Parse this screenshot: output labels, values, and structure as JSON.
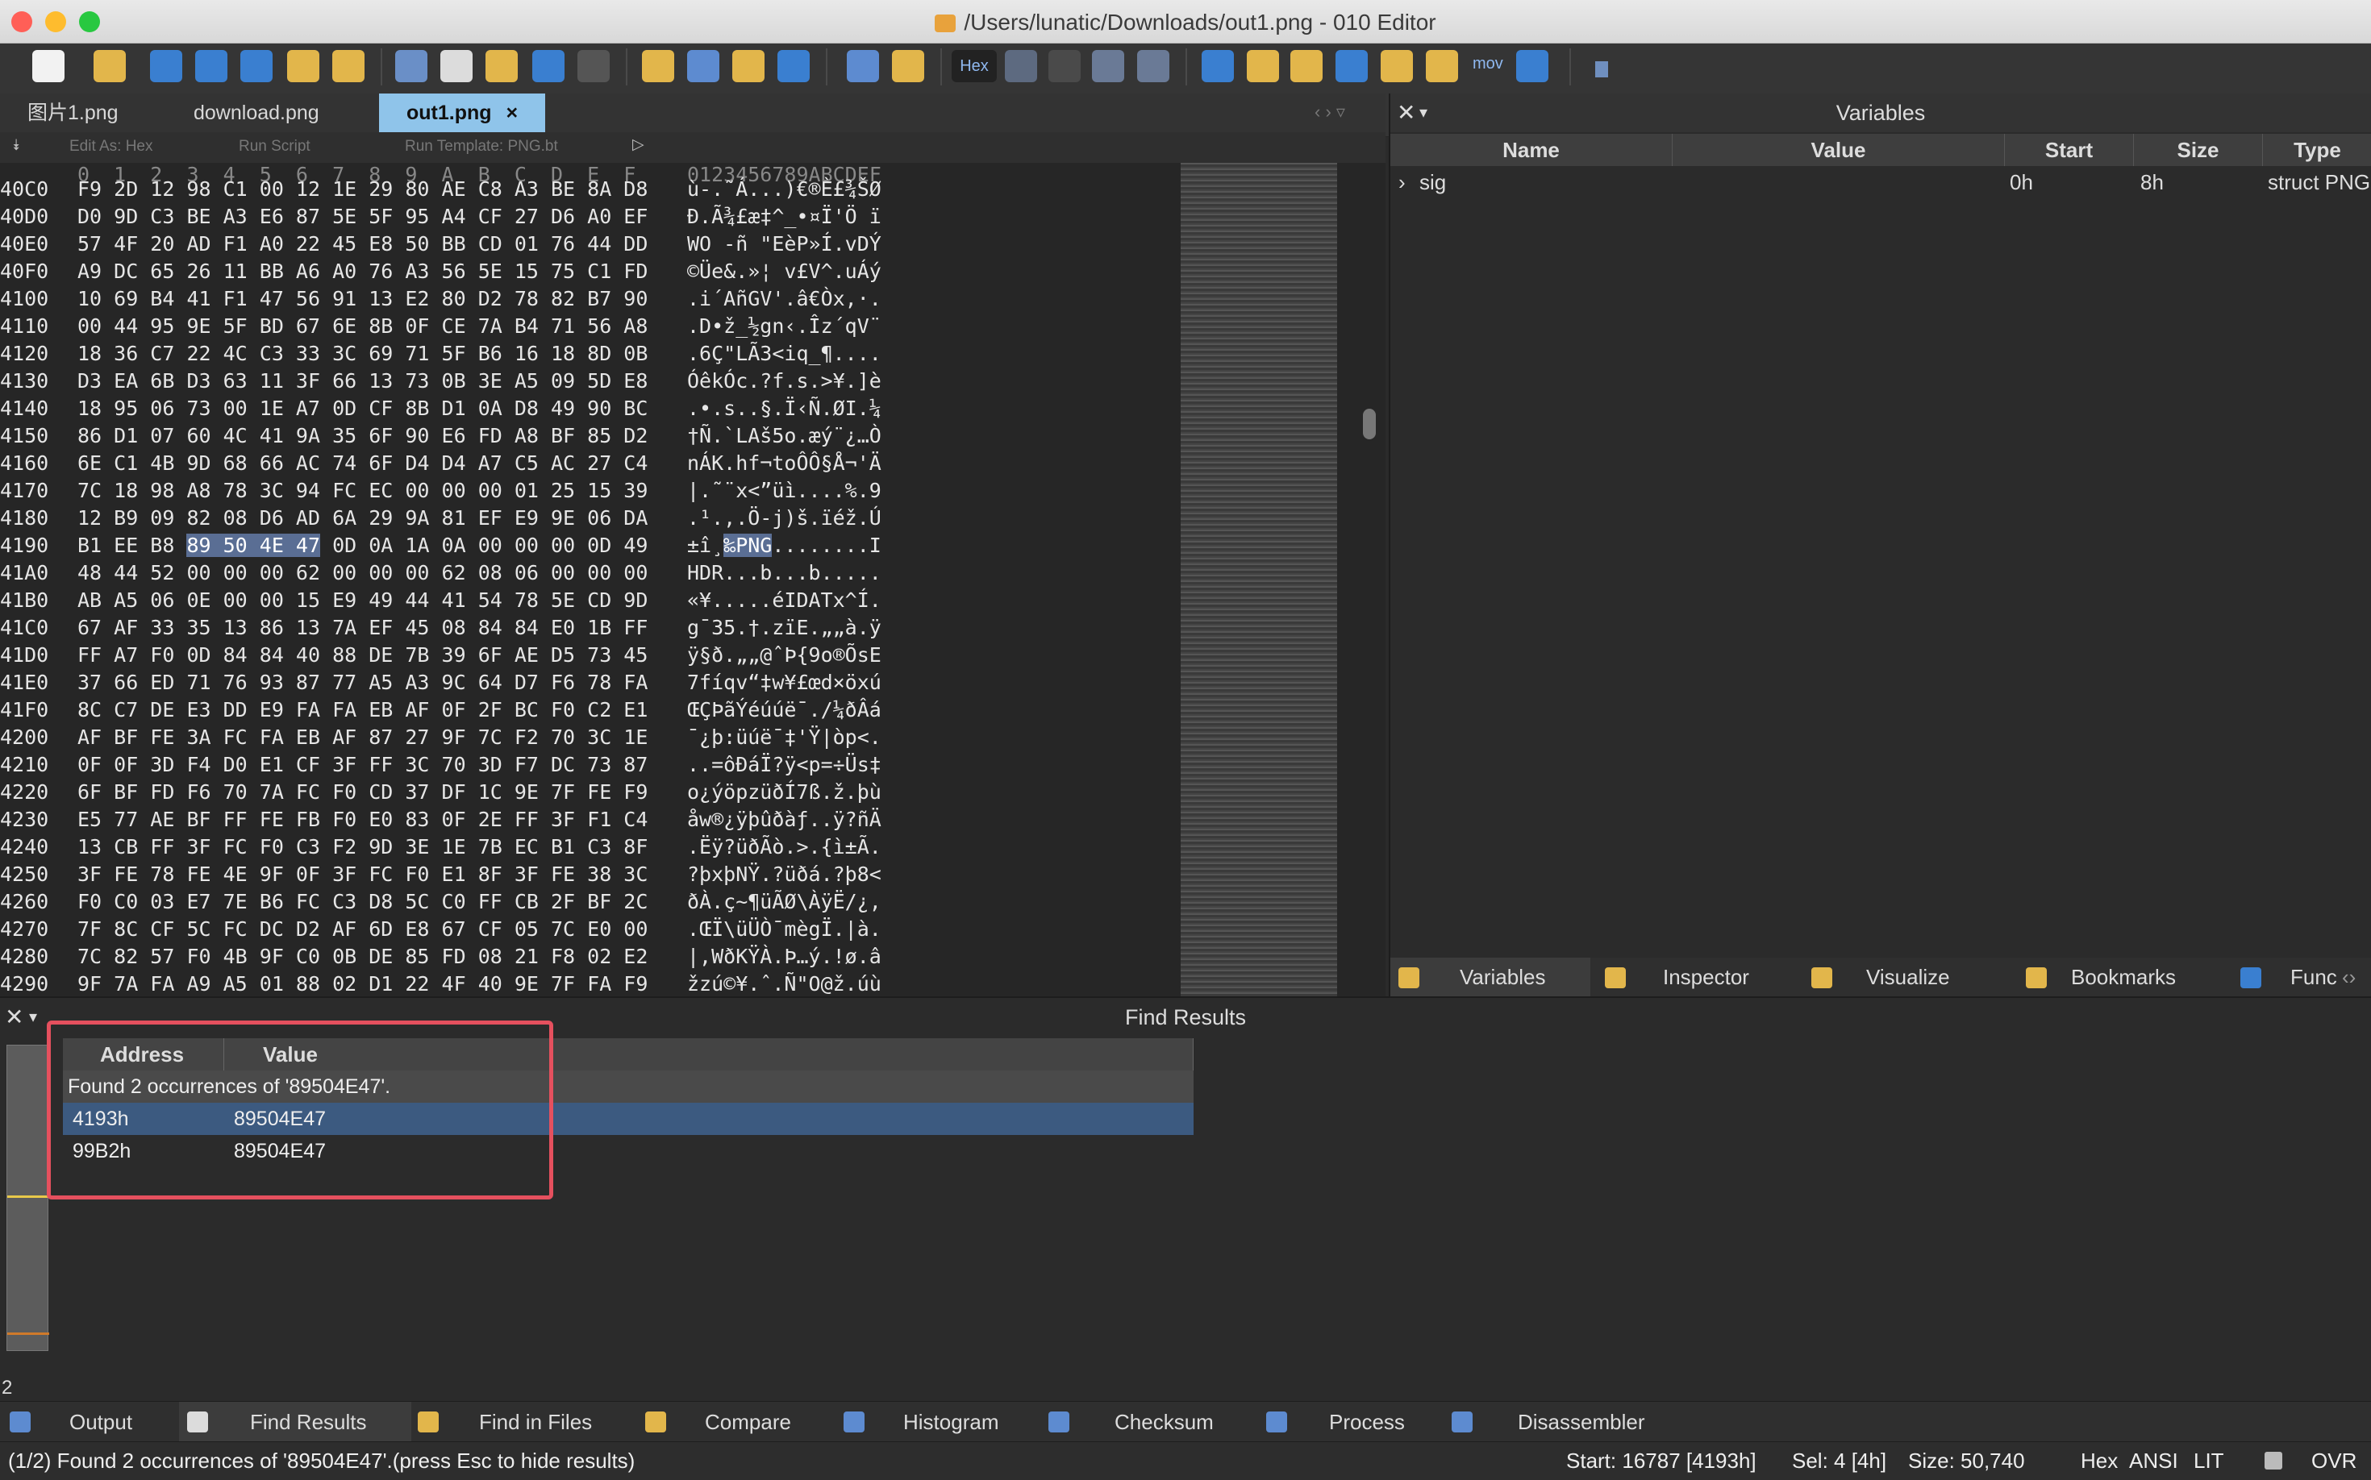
{
  "window": {
    "title": "/Users/lunatic/Downloads/out1.png - 010 Editor"
  },
  "toolbar": {
    "hex_label": "Hex",
    "mov_label": "mov"
  },
  "tabs": [
    {
      "label": "图片1.png"
    },
    {
      "label": "download.png"
    },
    {
      "label": "out1.png",
      "close": "×"
    }
  ],
  "hex_header": {
    "edit_as": "Edit As: Hex",
    "run_script": "Run Script",
    "run_template": "Run Template: PNG.bt"
  },
  "hex": {
    "columns": "0  1  2  3  4  5  6  7  8  9  A  B  C  D  E  F",
    "ascii_columns": "0123456789ABCDEF",
    "rows": [
      {
        "addr": "40C0",
        "bytes": "F9 2D 12 98 C1 00 12 1E 29 80 AE C8 A3 BE 8A D8",
        "ascii": "ù-.˜Á...)€®È£¾ŠØ"
      },
      {
        "addr": "40D0",
        "bytes": "D0 9D C3 BE A3 E6 87 5E 5F 95 A4 CF 27 D6 A0 EF",
        "ascii": "Ð.Ã¾£æ‡^_•¤Ï'Ö ï"
      },
      {
        "addr": "40E0",
        "bytes": "57 4F 20 AD F1 A0 22 45 E8 50 BB CD 01 76 44 DD",
        "ascii": "WO -ñ \"EèP»Í.vDÝ"
      },
      {
        "addr": "40F0",
        "bytes": "A9 DC 65 26 11 BB A6 A0 76 A3 56 5E 15 75 C1 FD",
        "ascii": "©Üe&.»¦ v£V^.uÁý"
      },
      {
        "addr": "4100",
        "bytes": "10 69 B4 41 F1 47 56 91 13 E2 80 D2 78 82 B7 90",
        "ascii": ".i´AñGV'.â€Òx‚·."
      },
      {
        "addr": "4110",
        "bytes": "00 44 95 9E 5F BD 67 6E 8B 0F CE 7A B4 71 56 A8",
        "ascii": ".D•ž_½gn‹.Îz´qV¨"
      },
      {
        "addr": "4120",
        "bytes": "18 36 C7 22 4C C3 33 3C 69 71 5F B6 16 18 8D 0B",
        "ascii": ".6Ç\"LÃ3<iq_¶...."
      },
      {
        "addr": "4130",
        "bytes": "D3 EA 6B D3 63 11 3F 66 13 73 0B 3E A5 09 5D E8",
        "ascii": "ÓêkÓc.?f.s.>¥.]è"
      },
      {
        "addr": "4140",
        "bytes": "18 95 06 73 00 1E A7 0D CF 8B D1 0A D8 49 90 BC",
        "ascii": ".•.s..§.Ï‹Ñ.ØI.¼"
      },
      {
        "addr": "4150",
        "bytes": "86 D1 07 60 4C 41 9A 35 6F 90 E6 FD A8 BF 85 D2",
        "ascii": "†Ñ.`LAš5o.æý¨¿…Ò"
      },
      {
        "addr": "4160",
        "bytes": "6E C1 4B 9D 68 66 AC 74 6F D4 D4 A7 C5 AC 27 C4",
        "ascii": "nÁK.hf¬toÔÔ§Å¬'Ä"
      },
      {
        "addr": "4170",
        "bytes": "7C 18 98 A8 78 3C 94 FC EC 00 00 00 01 25 15 39",
        "ascii": "|.˜¨x<”üì....%.9"
      },
      {
        "addr": "4180",
        "bytes": "12 B9 09 82 08 D6 AD 6A 29 9A 81 EF E9 9E 06 DA",
        "ascii": ".¹.‚.Ö-j)š.ïéž.Ú"
      },
      {
        "addr": "4190",
        "bytes_pre": "B1 EE B8 ",
        "bytes_sel": "89 50 4E 47",
        "bytes_post": " 0D 0A 1A 0A 00 00 00 0D 49",
        "ascii_pre": "±î¸",
        "ascii_sel": "‰PNG",
        "ascii_post": "........I"
      },
      {
        "addr": "41A0",
        "bytes": "48 44 52 00 00 00 62 00 00 00 62 08 06 00 00 00",
        "ascii": "HDR...b...b....."
      },
      {
        "addr": "41B0",
        "bytes": "AB A5 06 0E 00 00 15 E9 49 44 41 54 78 5E CD 9D",
        "ascii": "«¥.....éIDATx^Í."
      },
      {
        "addr": "41C0",
        "bytes": "67 AF 33 35 13 86 13 7A EF 45 08 84 84 E0 1B FF",
        "ascii": "g¯35.†.zïE.„„à.ÿ"
      },
      {
        "addr": "41D0",
        "bytes": "FF A7 F0 0D 84 84 40 88 DE 7B 39 6F AE D5 73 45",
        "ascii": "ÿ§ð.„„@ˆÞ{9o®ÕsE"
      },
      {
        "addr": "41E0",
        "bytes": "37 66 ED 71 76 93 87 77 A5 A3 9C 64 D7 F6 78 FA",
        "ascii": "7fíqv“‡w¥£œd×öxú"
      },
      {
        "addr": "41F0",
        "bytes": "8C C7 DE E3 DD E9 FA FA EB AF 0F 2F BC F0 C2 E1",
        "ascii": "ŒÇÞãÝéúúë¯./¼ðÂá"
      },
      {
        "addr": "4200",
        "bytes": "AF BF FE 3A FC FA EB AF 87 27 9F 7C F2 70 3C 1E",
        "ascii": "¯¿þ:üúë¯‡'Ÿ|òp<."
      },
      {
        "addr": "4210",
        "bytes": "0F 0F 3D F4 D0 E1 CF 3F FF 3C 70 3D F7 DC 73 87",
        "ascii": "..=ôÐáÏ?ÿ<p=÷Üs‡"
      },
      {
        "addr": "4220",
        "bytes": "6F BF FD F6 70 7A FC F0 CD 37 DF 1C 9E 7F FE F9",
        "ascii": "o¿ýöpzüðÍ7ß.ž.þù"
      },
      {
        "addr": "4230",
        "bytes": "E5 77 AE BF FF FE FB F0 E0 83 0F 2E FF 3F F1 C4",
        "ascii": "åw®¿ÿþûðàƒ..ÿ?ñÄ"
      },
      {
        "addr": "4240",
        "bytes": "13 CB FF 3F FC F0 C3 F2 9D 3E 1E 7B EC B1 C3 8F",
        "ascii": ".Ëÿ?üðÃò.>.{ì±Ã."
      },
      {
        "addr": "4250",
        "bytes": "3F FE 78 FE 4E 9F 0F 3F FC F0 E1 8F 3F FE 38 3C",
        "ascii": "?þxþNŸ.?üðá.?þ8<"
      },
      {
        "addr": "4260",
        "bytes": "F0 C0 03 E7 7E B6 FC C3 D8 5C C0 FF CB 2F BF 2C",
        "ascii": "ðÀ.ç~¶üÃØ\\ÀÿË/¿,"
      },
      {
        "addr": "4270",
        "bytes": "7F 8C CF 5C FC DC D2 AF 6D E8 67 CF 05 7C E0 00",
        "ascii": ".ŒÏ\\üÜÒ¯mègÏ.|à."
      },
      {
        "addr": "4280",
        "bytes": "7C 82 57 F0 4B 9F C0 0B DE 85 FD 08 21 F8 02 E2",
        "ascii": "|‚WðKŸÀ.Þ…ý.!ø.â"
      },
      {
        "addr": "4290",
        "bytes": "9F 7A FA A9 A5 01 88 02 D1 22 4F 40 9E 7F FA F9",
        "ascii": "žzú©¥.ˆ.Ñ\"O@ž.úù"
      }
    ]
  },
  "variables": {
    "title": "Variables",
    "columns": [
      "Name",
      "Value",
      "Start",
      "Size",
      "Type"
    ],
    "rows": [
      {
        "name": "sig",
        "value": "",
        "start": "0h",
        "size": "8h",
        "type": "struct PNG"
      }
    ],
    "tabs": [
      "Variables",
      "Inspector",
      "Visualize",
      "Bookmarks",
      "Func"
    ]
  },
  "find": {
    "title": "Find Results",
    "columns": [
      "Address",
      "Value"
    ],
    "summary": "Found 2 occurrences of '89504E47'.",
    "results": [
      {
        "address": "4193h",
        "value": "89504E47"
      },
      {
        "address": "99B2h",
        "value": "89504E47"
      }
    ],
    "count_label": "2"
  },
  "bottom_tabs": [
    "Output",
    "Find Results",
    "Find in Files",
    "Compare",
    "Histogram",
    "Checksum",
    "Process",
    "Disassembler"
  ],
  "status": {
    "message": "(1/2) Found 2 occurrences of '89504E47'.(press Esc to hide results)",
    "start": "Start: 16787 [4193h]",
    "sel": "Sel: 4 [4h]",
    "size": "Size: 50,740",
    "mode": "Hex",
    "encoding": "ANSI",
    "endian": "LIT",
    "ovr": "OVR"
  },
  "colors": {
    "accent_tab": "#8fc4ea",
    "selection": "#5a6e94",
    "highlight_box": "#e5505e",
    "row_selected": "#3c5a80"
  }
}
